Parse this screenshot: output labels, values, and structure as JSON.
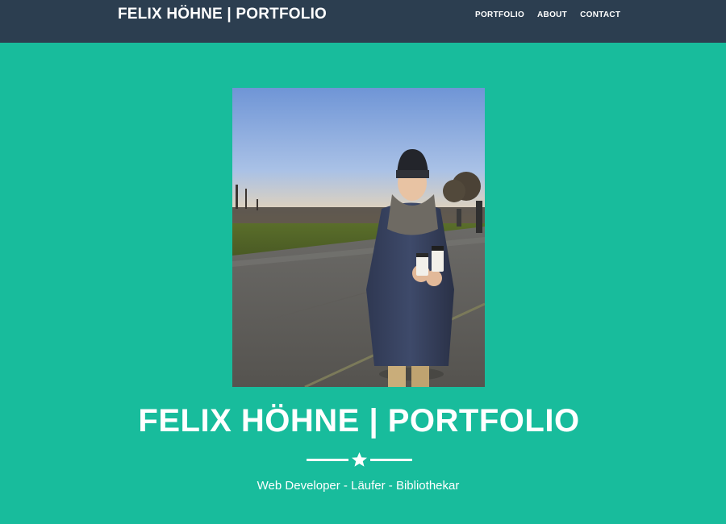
{
  "navbar": {
    "brand": "FELIX HÖHNE | PORTFOLIO",
    "links": [
      "PORTFOLIO",
      "ABOUT",
      "CONTACT"
    ]
  },
  "hero": {
    "photo_alt": "Portrait photo",
    "title": "FELIX HÖHNE | PORTFOLIO",
    "divider_icon": "star-icon",
    "subtitle": "Web Developer - Läufer - Bibliothekar"
  },
  "colors": {
    "navbar_bg": "#2c3e50",
    "hero_bg": "#18bc9c",
    "text": "#ffffff"
  }
}
